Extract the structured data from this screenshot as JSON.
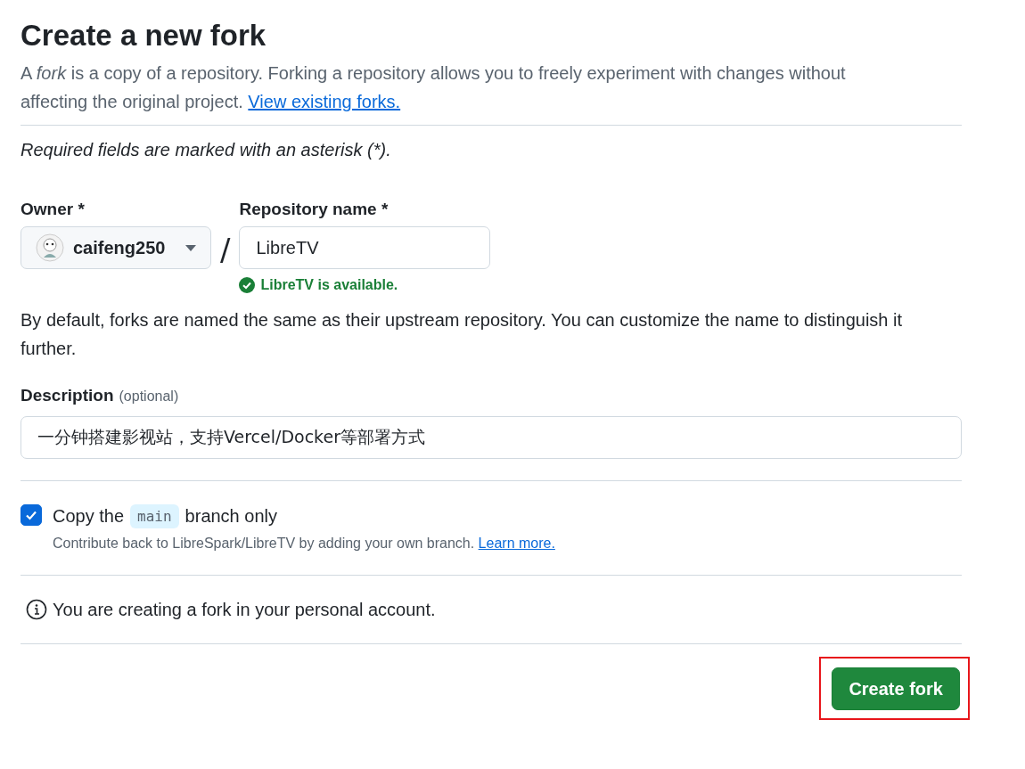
{
  "title": "Create a new fork",
  "intro": {
    "text": "A *fork* is a copy of a repository. Forking a repository allows you to freely experiment with changes without affecting the original project.",
    "link": "View existing forks."
  },
  "required_note": "Required fields are marked with an asterisk (*).",
  "owner": {
    "label": "Owner *",
    "value": "caifeng250"
  },
  "separator": "/",
  "repo_name": {
    "label": "Repository name *",
    "value": "LibreTV",
    "status": "LibreTV is available."
  },
  "naming_hint": "By default, forks are named the same as their upstream repository. You can customize the name to distinguish it further.",
  "description": {
    "label": "Description",
    "optional": "(optional)",
    "value": "一分钟搭建影视站，支持Vercel/Docker等部署方式"
  },
  "copy_branch": {
    "checked": true,
    "label_before": "Copy the",
    "branch": "main",
    "label_after": "branch only",
    "hint": "Contribute back to LibreSpark/LibreTV by adding your own branch.",
    "link": "Learn more."
  },
  "account_note": "You are creating a fork in your personal account.",
  "submit": {
    "label": "Create fork",
    "highlighted": true
  }
}
